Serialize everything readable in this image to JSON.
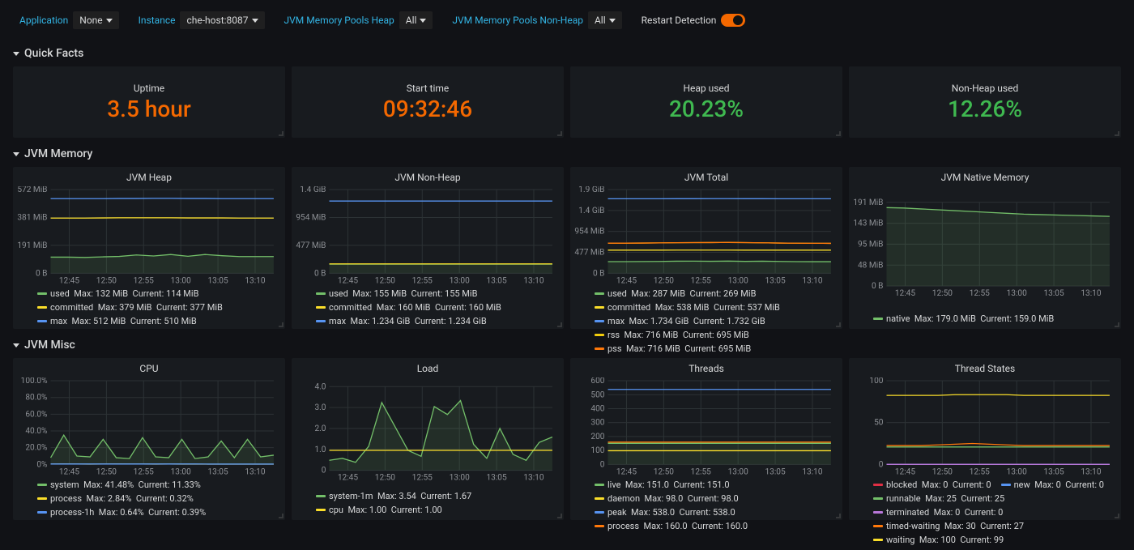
{
  "toolbar": {
    "application_label": "Application",
    "application_value": "None",
    "instance_label": "Instance",
    "instance_value": "che-host:8087",
    "pools_heap_label": "JVM Memory Pools Heap",
    "pools_heap_value": "All",
    "pools_nonheap_label": "JVM Memory Pools Non-Heap",
    "pools_nonheap_value": "All",
    "restart_label": "Restart Detection"
  },
  "sections": {
    "quick_facts": "Quick Facts",
    "jvm_memory": "JVM Memory",
    "jvm_misc": "JVM Misc"
  },
  "stats": {
    "uptime": {
      "title": "Uptime",
      "value": "3.5 hour"
    },
    "start_time": {
      "title": "Start time",
      "value": "09:32:46"
    },
    "heap_used": {
      "title": "Heap used",
      "value": "20.23%"
    },
    "nonheap_used": {
      "title": "Non-Heap used",
      "value": "12.26%"
    }
  },
  "chart_data": [
    {
      "id": "jvm_heap",
      "title": "JVM Heap",
      "type": "line",
      "xlabel": "",
      "ylabel": "",
      "yticks": [
        "0 B",
        "191 MiB",
        "381 MiB",
        "572 MiB"
      ],
      "xticks": [
        "12:45",
        "12:50",
        "12:55",
        "13:00",
        "13:05",
        "13:10"
      ],
      "ylim": [
        0,
        572
      ],
      "series": [
        {
          "name": "used",
          "color": "#73bf69",
          "values": [
            110,
            110,
            108,
            112,
            115,
            125,
            118,
            128,
            116,
            128,
            120,
            114,
            114,
            114
          ],
          "max": "132 MiB",
          "current": "114 MiB"
        },
        {
          "name": "committed",
          "color": "#fade2a",
          "values": [
            377,
            377,
            377,
            378,
            379,
            379,
            379,
            379,
            378,
            378,
            378,
            377,
            377,
            377
          ],
          "max": "379 MiB",
          "current": "377 MiB"
        },
        {
          "name": "max",
          "color": "#5794f2",
          "values": [
            510,
            510,
            510,
            510,
            511,
            511,
            512,
            512,
            511,
            511,
            510,
            510,
            510,
            510
          ],
          "max": "512 MiB",
          "current": "510 MiB"
        }
      ]
    },
    {
      "id": "jvm_nonheap",
      "title": "JVM Non-Heap",
      "type": "line",
      "yticks": [
        "0 B",
        "477 MiB",
        "954 MiB",
        "1.4 GiB"
      ],
      "xticks": [
        "12:45",
        "12:50",
        "12:55",
        "13:00",
        "13:05",
        "13:10"
      ],
      "ylim": [
        0,
        1430
      ],
      "series": [
        {
          "name": "used",
          "color": "#73bf69",
          "values": [
            155,
            155,
            155,
            155,
            155,
            155,
            155,
            155,
            155,
            155,
            155,
            155,
            155,
            155
          ],
          "max": "155 MiB",
          "current": "155 MiB"
        },
        {
          "name": "committed",
          "color": "#fade2a",
          "values": [
            160,
            160,
            160,
            160,
            160,
            160,
            160,
            160,
            160,
            160,
            160,
            160,
            160,
            160
          ],
          "max": "160 MiB",
          "current": "160 MiB"
        },
        {
          "name": "max",
          "color": "#5794f2",
          "values": [
            1234,
            1234,
            1234,
            1234,
            1234,
            1234,
            1234,
            1234,
            1234,
            1234,
            1234,
            1234,
            1234,
            1234
          ],
          "max": "1.234 GiB",
          "current": "1.234 GiB"
        }
      ]
    },
    {
      "id": "jvm_total",
      "title": "JVM Total",
      "type": "line",
      "yticks": [
        "0 B",
        "477 MiB",
        "954 MiB",
        "1.4 GiB",
        "1.9 GiB"
      ],
      "xticks": [
        "12:45",
        "12:50",
        "12:55",
        "13:00",
        "13:05",
        "13:10"
      ],
      "ylim": [
        0,
        1945
      ],
      "series": [
        {
          "name": "used",
          "color": "#73bf69",
          "values": [
            270,
            270,
            272,
            275,
            280,
            282,
            278,
            283,
            276,
            280,
            275,
            270,
            269,
            269
          ],
          "max": "287 MiB",
          "current": "269 MiB"
        },
        {
          "name": "committed",
          "color": "#fade2a",
          "values": [
            537,
            537,
            537,
            537,
            538,
            538,
            538,
            538,
            537,
            537,
            537,
            537,
            537,
            537
          ],
          "max": "538 MiB",
          "current": "537 MiB"
        },
        {
          "name": "max",
          "color": "#5794f2",
          "values": [
            1732,
            1732,
            1732,
            1732,
            1733,
            1733,
            1734,
            1734,
            1733,
            1733,
            1732,
            1732,
            1732,
            1732
          ],
          "max": "1.734 GiB",
          "current": "1.732 GiB"
        },
        {
          "name": "rss",
          "color": "#f2cc0c",
          "values": [
            700,
            700,
            702,
            705,
            710,
            712,
            714,
            716,
            712,
            708,
            702,
            698,
            696,
            695
          ],
          "max": "716 MiB",
          "current": "695 MiB"
        },
        {
          "name": "pss",
          "color": "#ff780a",
          "values": [
            700,
            700,
            702,
            705,
            710,
            712,
            714,
            716,
            712,
            708,
            702,
            698,
            696,
            695
          ],
          "max": "716 MiB",
          "current": "695 MiB"
        }
      ]
    },
    {
      "id": "jvm_native",
      "title": "JVM Native Memory",
      "type": "line",
      "yticks": [
        "0 B",
        "48 MiB",
        "95 MiB",
        "143 MiB",
        "191 MiB"
      ],
      "xticks": [
        "12:45",
        "12:50",
        "12:55",
        "13:00",
        "13:05",
        "13:10"
      ],
      "ylim": [
        0,
        191
      ],
      "series": [
        {
          "name": "native",
          "color": "#73bf69",
          "values": [
            179,
            178,
            176,
            174,
            172,
            170,
            168,
            166,
            164,
            163,
            162,
            161,
            160,
            159
          ],
          "max": "179.0 MiB",
          "current": "159.0 MiB"
        }
      ]
    },
    {
      "id": "cpu",
      "title": "CPU",
      "type": "line",
      "yticks": [
        "0%",
        "20.0%",
        "40.0%",
        "60.0%",
        "80.0%",
        "100.0%"
      ],
      "xticks": [
        "12:45",
        "12:50",
        "12:55",
        "13:00",
        "13:05",
        "13:10"
      ],
      "ylim": [
        0,
        100
      ],
      "series": [
        {
          "name": "system",
          "color": "#73bf69",
          "values": [
            8,
            35,
            10,
            9,
            30,
            8,
            7,
            32,
            9,
            8,
            30,
            7,
            9,
            28,
            8,
            30,
            9,
            11
          ],
          "max": "41.48%",
          "current": "11.33%"
        },
        {
          "name": "process",
          "color": "#fade2a",
          "values": [
            0.5,
            0.6,
            0.5,
            0.4,
            0.5,
            0.6,
            0.5,
            0.5,
            0.4,
            0.5,
            0.4,
            0.4,
            0.3,
            0.3,
            0.3,
            0.3,
            0.3,
            0.32
          ],
          "max": "2.84%",
          "current": "0.32%"
        },
        {
          "name": "process-1h",
          "color": "#5794f2",
          "values": [
            0.5,
            0.5,
            0.5,
            0.5,
            0.5,
            0.5,
            0.5,
            0.5,
            0.5,
            0.5,
            0.5,
            0.5,
            0.4,
            0.4,
            0.4,
            0.4,
            0.4,
            0.39
          ],
          "max": "0.64%",
          "current": "0.39%"
        }
      ]
    },
    {
      "id": "load",
      "title": "Load",
      "type": "line",
      "yticks": [
        "0",
        "1.0",
        "2.0",
        "3.0",
        "4.0"
      ],
      "xticks": [
        "12:45",
        "12:50",
        "12:55",
        "13:00",
        "13:05",
        "13:10"
      ],
      "ylim": [
        0,
        4.2
      ],
      "series": [
        {
          "name": "system-1m",
          "color": "#73bf69",
          "values": [
            0.5,
            0.6,
            0.4,
            1.2,
            3.4,
            2.2,
            1.0,
            0.7,
            3.2,
            2.8,
            3.5,
            1.3,
            0.6,
            2.1,
            0.8,
            0.5,
            1.4,
            1.67
          ],
          "max": "3.54",
          "current": "1.67"
        },
        {
          "name": "cpu",
          "color": "#fade2a",
          "values": [
            1,
            1,
            1,
            1,
            1,
            1,
            1,
            1,
            1,
            1,
            1,
            1,
            1,
            1,
            1,
            1,
            1,
            1
          ],
          "max": "1.00",
          "current": "1.00"
        }
      ]
    },
    {
      "id": "threads",
      "title": "Threads",
      "type": "line",
      "yticks": [
        "0",
        "100",
        "200",
        "300",
        "400",
        "500",
        "600"
      ],
      "xticks": [
        "12:45",
        "12:50",
        "12:55",
        "13:00",
        "13:05",
        "13:10"
      ],
      "ylim": [
        0,
        600
      ],
      "series": [
        {
          "name": "live",
          "color": "#73bf69",
          "values": [
            151,
            151,
            151,
            151,
            151,
            151,
            151,
            151,
            151,
            151,
            151,
            151,
            151,
            151
          ],
          "max": "151.0",
          "current": "151.0"
        },
        {
          "name": "daemon",
          "color": "#fade2a",
          "values": [
            98,
            98,
            98,
            98,
            98,
            98,
            98,
            98,
            98,
            98,
            98,
            98,
            98,
            98
          ],
          "max": "98.0",
          "current": "98.0"
        },
        {
          "name": "peak",
          "color": "#5794f2",
          "values": [
            538,
            538,
            538,
            538,
            538,
            538,
            538,
            538,
            538,
            538,
            538,
            538,
            538,
            538
          ],
          "max": "538.0",
          "current": "538.0"
        },
        {
          "name": "process",
          "color": "#ff780a",
          "values": [
            160,
            160,
            160,
            160,
            160,
            160,
            160,
            160,
            160,
            160,
            160,
            160,
            160,
            160
          ],
          "max": "160.0",
          "current": "160.0"
        }
      ]
    },
    {
      "id": "thread_states",
      "title": "Thread States",
      "type": "line",
      "yticks": [
        "0",
        "50",
        "100"
      ],
      "xticks": [
        "12:45",
        "12:50",
        "12:55",
        "13:00",
        "13:05",
        "13:10"
      ],
      "ylim": [
        0,
        120
      ],
      "series": [
        {
          "name": "blocked",
          "color": "#e02f44",
          "values": [
            0,
            0,
            0,
            0,
            0,
            0,
            0,
            0,
            0,
            0,
            0,
            0,
            0,
            0
          ],
          "max": "0",
          "current": "0"
        },
        {
          "name": "new",
          "color": "#5794f2",
          "values": [
            0,
            0,
            0,
            0,
            0,
            0,
            0,
            0,
            0,
            0,
            0,
            0,
            0,
            0
          ],
          "max": "0",
          "current": "0"
        },
        {
          "name": "runnable",
          "color": "#73bf69",
          "values": [
            25,
            25,
            25,
            25,
            25,
            25,
            25,
            25,
            25,
            25,
            25,
            25,
            25,
            25
          ],
          "max": "25",
          "current": "25"
        },
        {
          "name": "terminated",
          "color": "#b877d9",
          "values": [
            0,
            0,
            0,
            0,
            0,
            0,
            0,
            0,
            0,
            0,
            0,
            0,
            0,
            0
          ],
          "max": "0",
          "current": "0"
        },
        {
          "name": "timed-waiting",
          "color": "#ff780a",
          "values": [
            27,
            27,
            27,
            28,
            29,
            30,
            29,
            28,
            27,
            27,
            27,
            27,
            27,
            27
          ],
          "max": "30",
          "current": "27"
        },
        {
          "name": "waiting",
          "color": "#fade2a",
          "values": [
            99,
            99,
            99,
            99,
            100,
            100,
            100,
            100,
            99,
            99,
            99,
            99,
            99,
            99
          ],
          "max": "100",
          "current": "99"
        }
      ]
    }
  ]
}
